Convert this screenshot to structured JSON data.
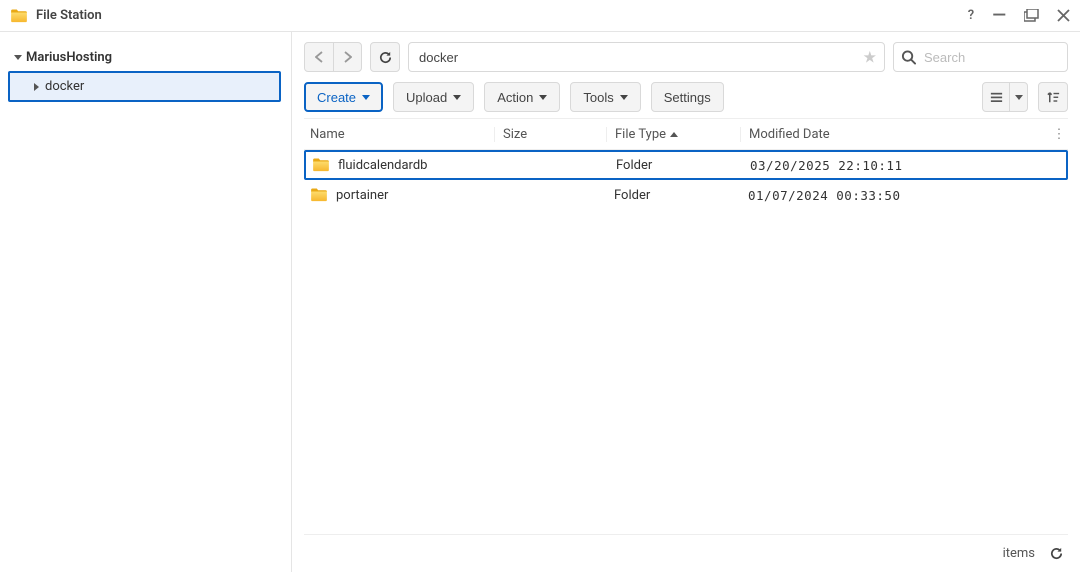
{
  "title": "File Station",
  "sidebar": {
    "root": "MariusHosting",
    "item": "docker"
  },
  "path": {
    "value": "docker"
  },
  "search": {
    "placeholder": "Search"
  },
  "toolbar": {
    "create": "Create",
    "upload": "Upload",
    "action": "Action",
    "tools": "Tools",
    "settings": "Settings"
  },
  "columns": {
    "name": "Name",
    "size": "Size",
    "type": "File Type",
    "modified": "Modified Date"
  },
  "rows": [
    {
      "name": "fluidcalendardb",
      "type": "Folder",
      "modified": "03/20/2025 22:10:11",
      "selected": true
    },
    {
      "name": "portainer",
      "type": "Folder",
      "modified": "01/07/2024 00:33:50",
      "selected": false
    }
  ],
  "footer": {
    "items_label": "items"
  }
}
